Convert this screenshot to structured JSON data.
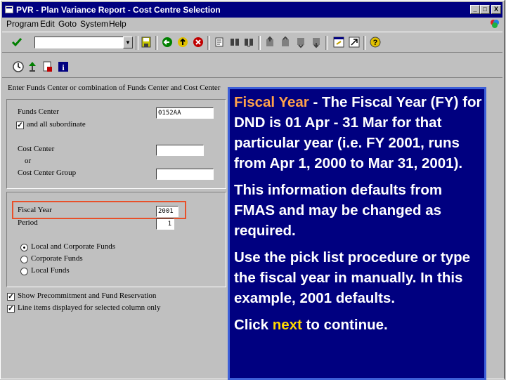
{
  "window": {
    "title": "PVR - Plan Variance Report - Cost Centre Selection",
    "minimize": "_",
    "maximize": "□",
    "close": "X"
  },
  "menu": [
    "Program",
    "Edit",
    "Goto",
    "System",
    "Help"
  ],
  "toolbar": {
    "command_field": "",
    "icons": [
      "check-icon",
      "save-icon",
      "back-icon",
      "exit-icon",
      "cancel-icon",
      "print-icon",
      "find-icon",
      "find-next-icon",
      "first-page-icon",
      "prev-page-icon",
      "next-page-icon",
      "last-page-icon",
      "new-session-icon",
      "shortcut-icon",
      "help-icon"
    ]
  },
  "app_toolbar": {
    "icons": [
      "execute-icon",
      "tree-icon",
      "variant-icon",
      "info-icon"
    ]
  },
  "selection": {
    "heading": "Enter Funds Center or combination of Funds Center and Cost Center",
    "funds_center_label": "Funds Center",
    "funds_center_value": "0152AA",
    "all_subordinate_label": "and all subordinate",
    "cost_center_label": "Cost Center",
    "or_label": "or",
    "cost_center_group_label": "Cost Center Group",
    "fiscal_year_label": "Fiscal Year",
    "fiscal_year_value": "2001",
    "period_label": "Period",
    "period_value": "1",
    "radio_local_corporate": "Local and Corporate Funds",
    "radio_corporate": "Corporate Funds",
    "radio_local": "Local Funds",
    "show_precommitment": "Show Precommitment and Fund Reservation",
    "line_items": "Line items displayed for selected column only"
  },
  "info": {
    "p1_term": "Fiscal Year",
    "p1_text": " - The Fiscal Year (FY) for DND is 01 Apr - 31 Mar for that particular year (i.e. FY 2001, runs from Apr 1, 2000 to Mar 31, 2001).",
    "p2_text": "This information defaults from FMAS and may be changed as required.",
    "p3_text": "Use the pick list procedure or type the fiscal year in manually.  In this example, 2001 defaults.",
    "p4_pre": "Click ",
    "p4_link": "next",
    "p4_post": " to continue."
  },
  "colors": {
    "title_bg": "#000080",
    "info_bg": "#000080",
    "info_border": "#3d5fd8",
    "highlight": "#e8502a",
    "term": "#ffa24a",
    "next_link": "#ffd800"
  }
}
